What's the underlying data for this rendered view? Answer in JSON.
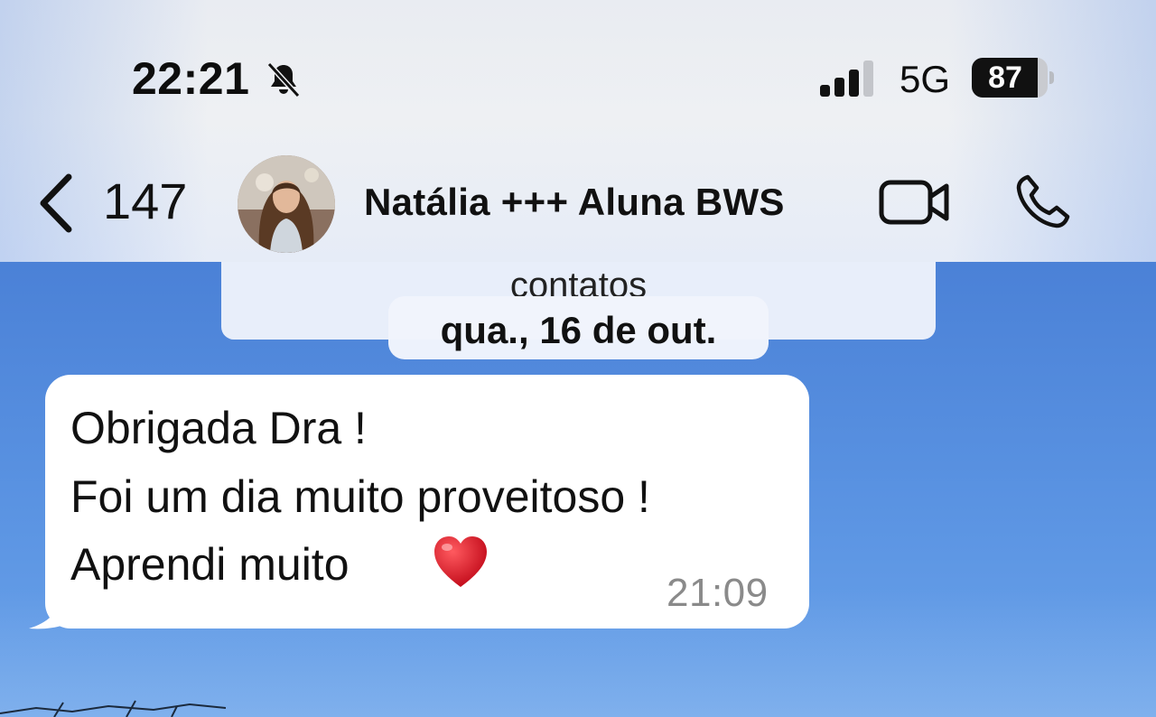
{
  "status_bar": {
    "time": "22:21",
    "network": "5G",
    "battery_percent": "87",
    "battery_level": 0.87,
    "icons": [
      "bell-slash-icon",
      "signal-bars-icon",
      "battery-icon"
    ]
  },
  "chat_header": {
    "back_count": "147",
    "contact_name": "Natália +++ Aluna BWS",
    "icons": [
      "chevron-left-icon",
      "avatar",
      "video-camera-icon",
      "phone-icon"
    ]
  },
  "conversation": {
    "system_message_partial": "contatos",
    "date_separator": "qua., 16 de out.",
    "messages": [
      {
        "lines": [
          "Obrigada Dra !",
          "Foi um dia muito proveitoso !",
          "Aprendi muito"
        ],
        "emoji": "heart-icon",
        "time": "21:09"
      }
    ]
  },
  "colors": {
    "background_sky": "#4a80d6",
    "bubble": "#ffffff",
    "header": "#eef0f3",
    "heart": "#e0192b"
  }
}
